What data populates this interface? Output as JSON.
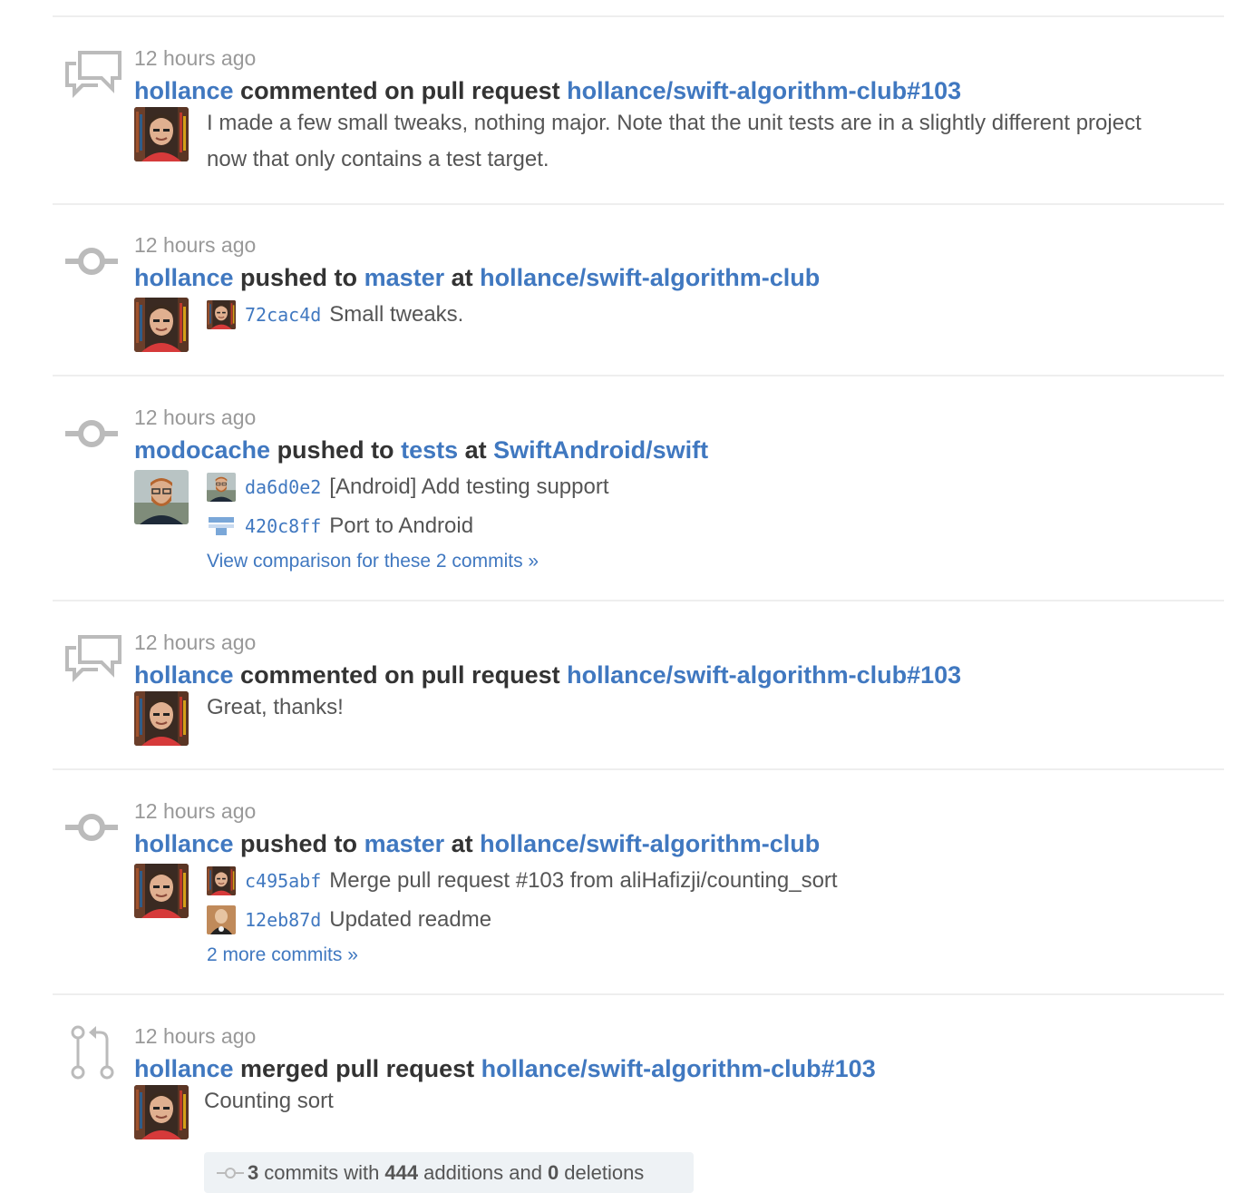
{
  "events": [
    {
      "time": "12 hours ago",
      "icon": "comment-discussion-icon",
      "actor": "hollance",
      "action": "commented on pull request",
      "target": "hollance/swift-algorithm-club#103",
      "body": "I made a few small tweaks, nothing major. Note that the unit tests are in a slightly different project now that only contains a test target."
    },
    {
      "time": "12 hours ago",
      "icon": "git-commit-icon",
      "actor": "hollance",
      "action": "pushed to",
      "branch": "master",
      "connector": "at",
      "repo": "hollance/swift-algorithm-club",
      "commits": [
        {
          "sha": "72cac4d",
          "message": "Small tweaks."
        }
      ]
    },
    {
      "time": "12 hours ago",
      "icon": "git-commit-icon",
      "actor": "modocache",
      "action": "pushed to",
      "branch": "tests",
      "connector": "at",
      "repo": "SwiftAndroid/swift",
      "commits": [
        {
          "sha": "da6d0e2",
          "message": "[Android] Add testing support"
        },
        {
          "sha": "420c8ff",
          "message": "Port to Android"
        }
      ],
      "more": "View comparison for these 2 commits »"
    },
    {
      "time": "12 hours ago",
      "icon": "comment-discussion-icon",
      "actor": "hollance",
      "action": "commented on pull request",
      "target": "hollance/swift-algorithm-club#103",
      "body": "Great, thanks!"
    },
    {
      "time": "12 hours ago",
      "icon": "git-commit-icon",
      "actor": "hollance",
      "action": "pushed to",
      "branch": "master",
      "connector": "at",
      "repo": "hollance/swift-algorithm-club",
      "commits": [
        {
          "sha": "c495abf",
          "message": "Merge pull request #103 from aliHafizji/counting_sort"
        },
        {
          "sha": "12eb87d",
          "message": "Updated readme"
        }
      ],
      "more": "2 more commits »"
    },
    {
      "time": "12 hours ago",
      "icon": "git-pull-request-icon",
      "actor": "hollance",
      "action": "merged pull request",
      "target": "hollance/swift-algorithm-club#103",
      "body": "Counting sort",
      "summary": {
        "commits": "3",
        "commits_text": "commits with",
        "additions": "444",
        "additions_text": "additions and",
        "deletions": "0",
        "deletions_text": "deletions"
      }
    }
  ],
  "colors": {
    "link": "#4078c0",
    "muted": "#999999",
    "text": "#333333",
    "icon": "#bbbbbb",
    "divider": "#eeeeee"
  }
}
